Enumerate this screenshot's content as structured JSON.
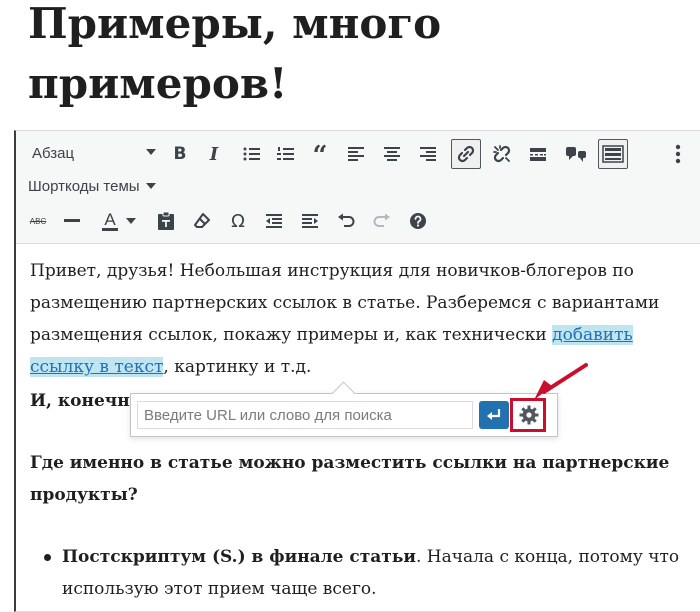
{
  "page": {
    "heading": "Примеры, много примеров!"
  },
  "toolbar": {
    "format_value": "Абзац",
    "shortcodes_label": "Шорткоды темы",
    "icons": [
      "bold-icon",
      "italic-icon",
      "bullet-list-icon",
      "numbered-list-icon",
      "quote-icon",
      "align-left-icon",
      "align-center-icon",
      "align-right-icon",
      "link-icon",
      "unlink-icon",
      "read-more-icon",
      "shortcode-icon",
      "toolbar-toggle-icon",
      "more-vertical-icon",
      "strikethrough-icon",
      "horizontal-line-icon",
      "text-color-icon",
      "paste-text-icon",
      "clear-formatting-icon",
      "special-char-icon",
      "outdent-icon",
      "indent-icon",
      "undo-icon",
      "redo-icon",
      "help-icon"
    ],
    "abc_label": "ABC",
    "text_color_label": "A",
    "omega_label": "Ω"
  },
  "content": {
    "p1_start": "Привет, друзья! Небольшая инструкция для новичков-блогеров по размещению партнерских ссылок в статье. Разберемся с вариантами размещения ссылок, покажу примеры и, как технически ",
    "p1_link": "добавить ссылку в текст",
    "p1_end": ", картинку и т.д.",
    "p2_visible": "И, конечно",
    "p2_tail": ":",
    "p3": "Где именно в статье можно разместить ссылки на партнерские продукты?",
    "bullet1_bold": "Постскриптум (S.) в финале статьи",
    "bullet1_rest": ". Начала с конца, потому что использую этот прием чаще всего."
  },
  "link_popup": {
    "placeholder": "Введите URL или слово для поиска",
    "accent_color": "#2271b1"
  },
  "annotation": {
    "color": "#c8102e"
  }
}
